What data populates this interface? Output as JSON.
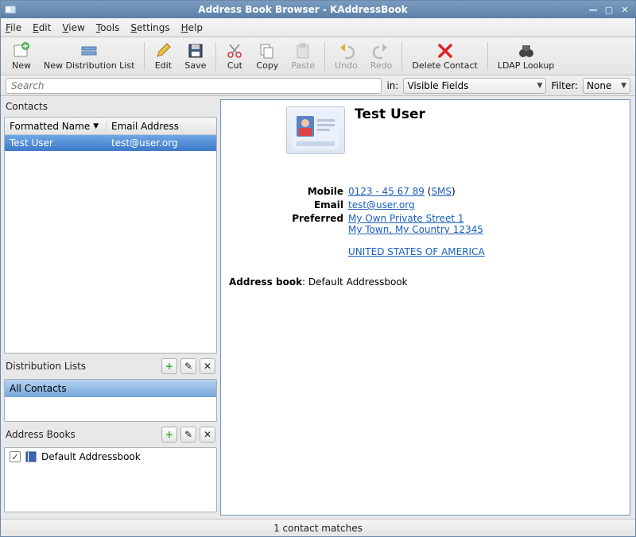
{
  "window": {
    "title": "Address Book Browser - KAddressBook"
  },
  "menu": {
    "file": "File",
    "edit": "Edit",
    "view": "View",
    "tools": "Tools",
    "settings": "Settings",
    "help": "Help"
  },
  "toolbar": {
    "new": "New",
    "newdist": "New Distribution List",
    "edit": "Edit",
    "save": "Save",
    "cut": "Cut",
    "copy": "Copy",
    "paste": "Paste",
    "undo": "Undo",
    "redo": "Redo",
    "delcontact": "Delete Contact",
    "ldap": "LDAP Lookup"
  },
  "search": {
    "placeholder": "Search",
    "in_label": "in:",
    "in_value": "Visible Fields",
    "filter_label": "Filter:",
    "filter_value": "None"
  },
  "panels": {
    "contacts": {
      "label": "Contacts",
      "columns": [
        "Formatted Name",
        "Email Address"
      ],
      "rows": [
        {
          "name": "Test User",
          "email": "test@user.org",
          "selected": true
        }
      ]
    },
    "dist": {
      "label": "Distribution Lists",
      "rows": [
        {
          "name": "All Contacts",
          "selected": true
        }
      ]
    },
    "ab": {
      "label": "Address Books",
      "rows": [
        {
          "name": "Default Addressbook",
          "checked": true
        }
      ]
    }
  },
  "detail": {
    "name": "Test User",
    "mobile_label": "Mobile",
    "mobile": "0123 - 45 67 89",
    "sms": "SMS",
    "email_label": "Email",
    "email": "test@user.org",
    "pref_label": "Preferred",
    "street": "My Own Private Street 1",
    "city": "My Town, My Country 12345",
    "country": "UNITED STATES OF AMERICA",
    "ab_label": "Address book",
    "ab_value": "Default Addressbook"
  },
  "status": {
    "text": "1 contact matches"
  }
}
